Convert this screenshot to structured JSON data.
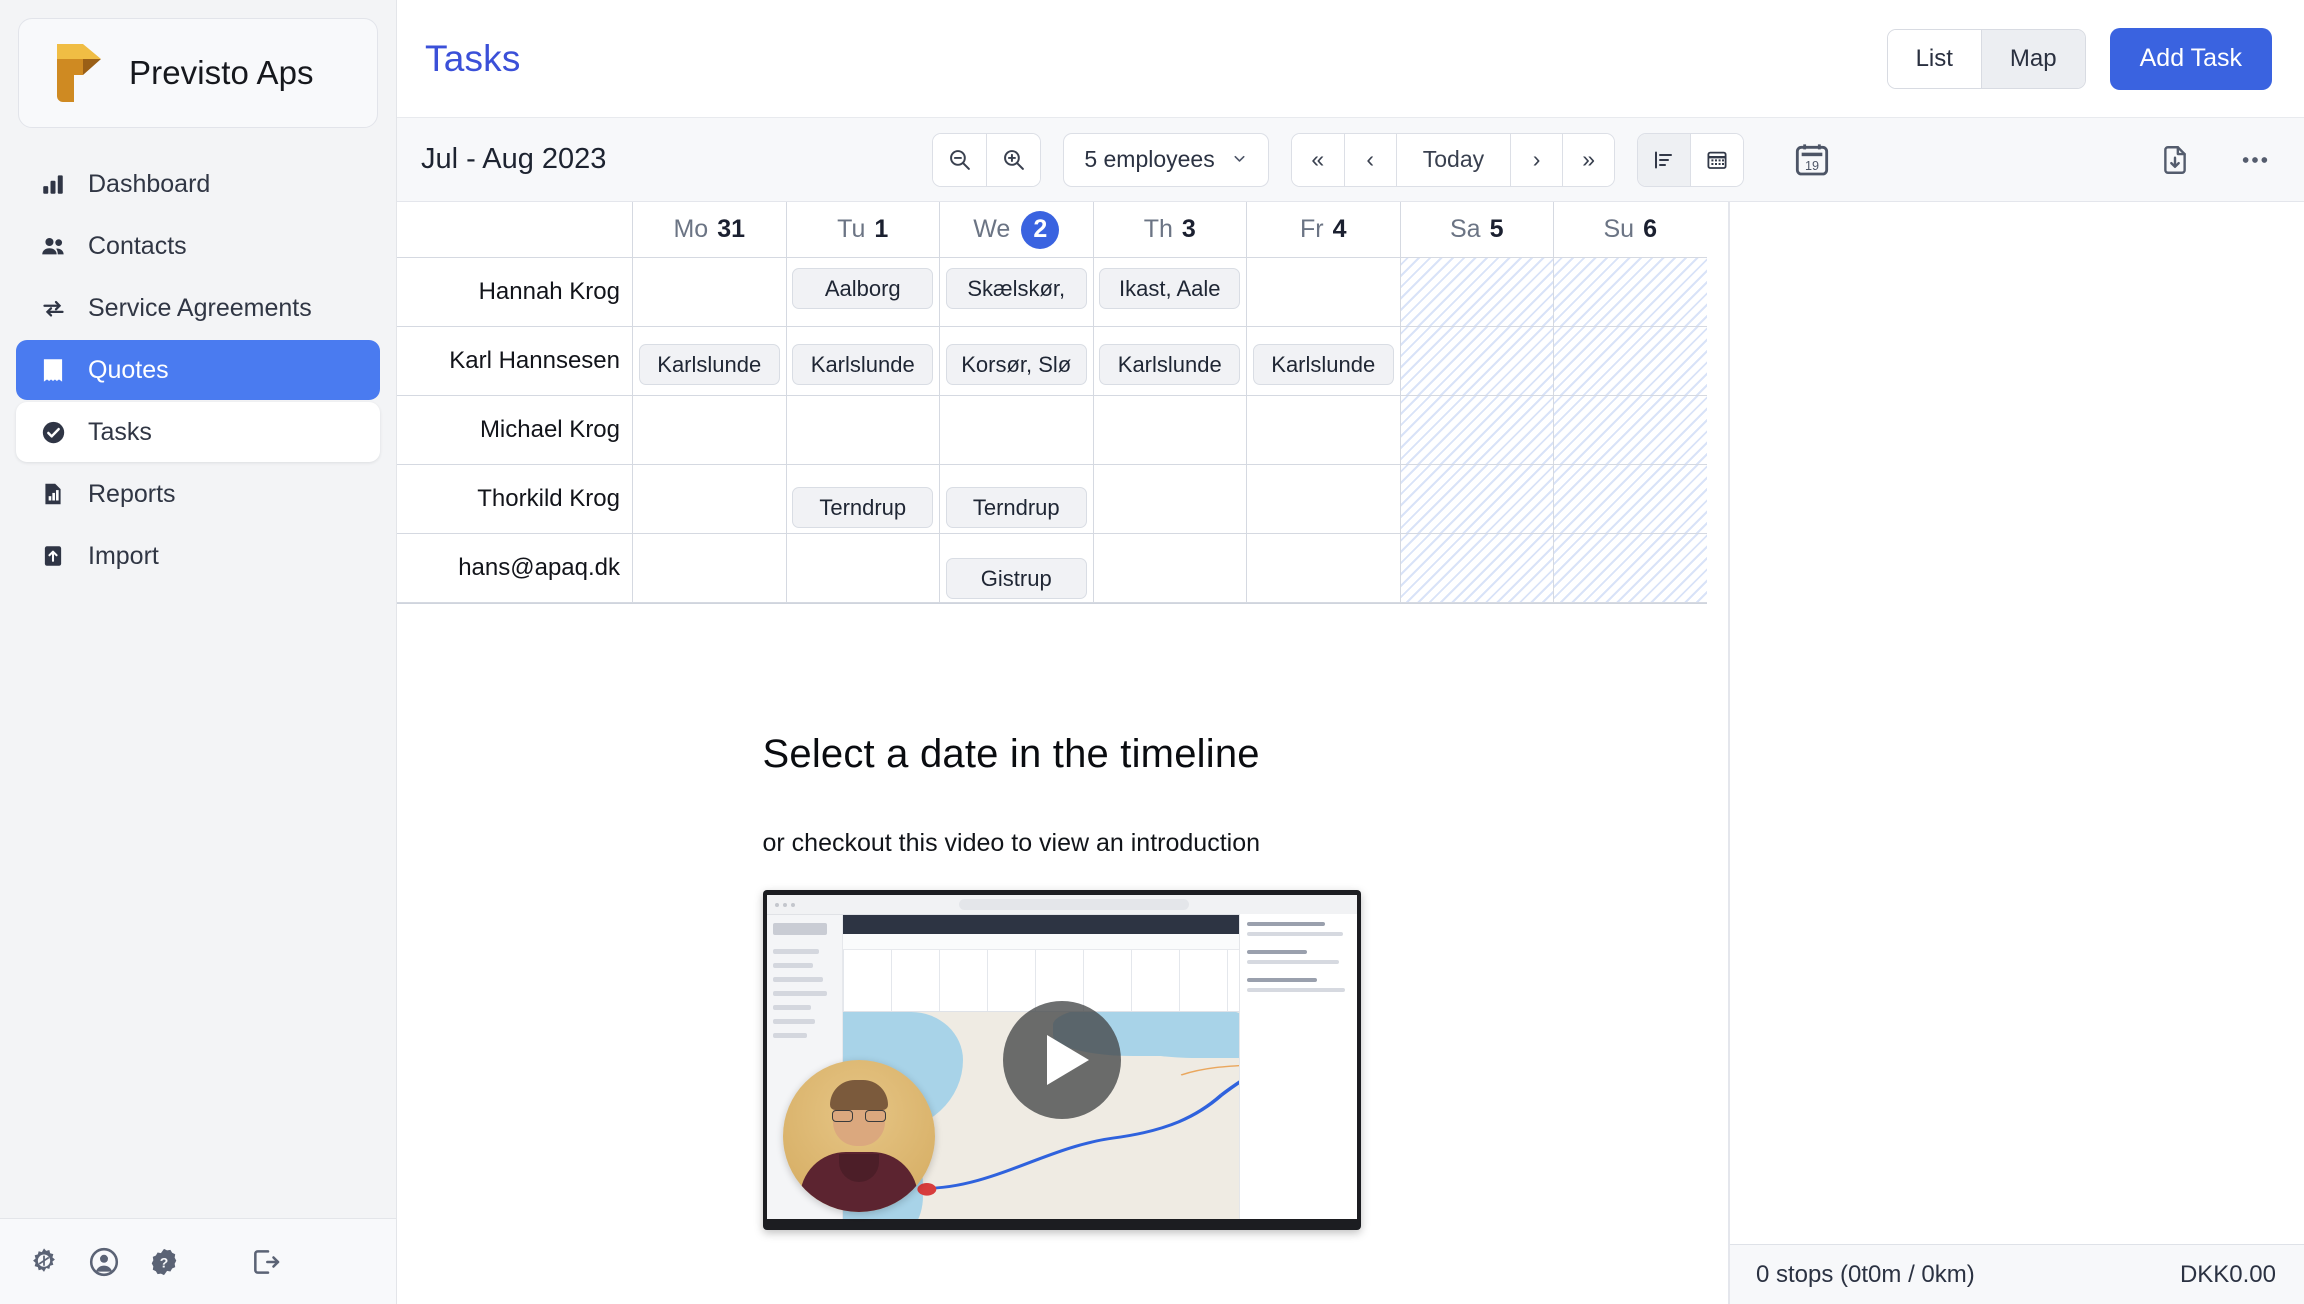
{
  "brand": {
    "name": "Previsto Aps",
    "logo_colors": [
      "#f2b63c",
      "#c67f1e",
      "#8a4e12"
    ]
  },
  "sidebar": {
    "items": [
      {
        "label": "Dashboard",
        "icon": "bar-chart-icon",
        "state": "normal"
      },
      {
        "label": "Contacts",
        "icon": "people-icon",
        "state": "normal"
      },
      {
        "label": "Service Agreements",
        "icon": "refresh-cycle-icon",
        "state": "normal"
      },
      {
        "label": "Quotes",
        "icon": "receipt-icon",
        "state": "active"
      },
      {
        "label": "Tasks",
        "icon": "check-circle-icon",
        "state": "hover"
      },
      {
        "label": "Reports",
        "icon": "report-icon",
        "state": "normal"
      },
      {
        "label": "Import",
        "icon": "upload-box-icon",
        "state": "normal"
      }
    ],
    "footer_icons": [
      "settings-gear-icon",
      "account-circle-icon",
      "help-question-icon",
      "logout-icon"
    ],
    "active_color": "#4a7bf0"
  },
  "header": {
    "title": "Tasks",
    "title_color": "#3b50d8",
    "view_toggle": {
      "options": [
        "List",
        "Map"
      ],
      "selected": "Map"
    },
    "add_task_label": "Add Task",
    "add_task_color": "#3a63e0"
  },
  "toolbar": {
    "period": "Jul - Aug 2023",
    "zoom_out_icon": "zoom-out-icon",
    "zoom_in_icon": "zoom-in-icon",
    "employee_filter": "5 employees",
    "nav": {
      "first": "«",
      "prev": "‹",
      "today": "Today",
      "next": "›",
      "last": "»"
    },
    "display_toggle": {
      "options": [
        "gantt-list-icon",
        "calendar-grid-icon"
      ],
      "selected": "gantt-list-icon"
    },
    "date_picker_icon": "calendar-19-icon",
    "date_picker_day": "19",
    "export_icon": "file-download-icon",
    "more_icon": "more-horizontal-icon"
  },
  "timeline": {
    "days": [
      {
        "dow": "Mo",
        "num": "31",
        "today": false,
        "weekend": false
      },
      {
        "dow": "Tu",
        "num": "1",
        "today": false,
        "weekend": false
      },
      {
        "dow": "We",
        "num": "2",
        "today": true,
        "weekend": false
      },
      {
        "dow": "Th",
        "num": "3",
        "today": false,
        "weekend": false
      },
      {
        "dow": "Fr",
        "num": "4",
        "today": false,
        "weekend": false
      },
      {
        "dow": "Sa",
        "num": "5",
        "today": false,
        "weekend": true
      },
      {
        "dow": "Su",
        "num": "6",
        "today": false,
        "weekend": true
      }
    ],
    "rows": [
      {
        "name": "Hannah Krog",
        "cells": [
          "",
          "Aalborg",
          "Skælskør,",
          "Ikast, Aale",
          "",
          "",
          ""
        ]
      },
      {
        "name": "Karl Hannsesen",
        "cells": [
          "Karlslunde",
          "Karlslunde",
          "Korsør, Slø",
          "Karlslunde",
          "Karlslunde",
          "",
          ""
        ]
      },
      {
        "name": "Michael Krog",
        "cells": [
          "",
          "",
          "",
          "",
          "",
          "",
          ""
        ]
      },
      {
        "name": "Thorkild Krog",
        "cells": [
          "",
          "Terndrup",
          "Terndrup",
          "",
          "",
          "",
          ""
        ]
      },
      {
        "name": "hans@apaq.dk",
        "cells": [
          "",
          "",
          "Gistrup",
          "",
          "",
          "",
          ""
        ]
      }
    ]
  },
  "empty_state": {
    "heading": "Select a date in the timeline",
    "subtext": "or checkout this video to view an introduction",
    "play_icon": "play-button-icon"
  },
  "status_bar": {
    "stops": "0 stops (0t0m / 0km)",
    "amount": "DKK0.00"
  }
}
